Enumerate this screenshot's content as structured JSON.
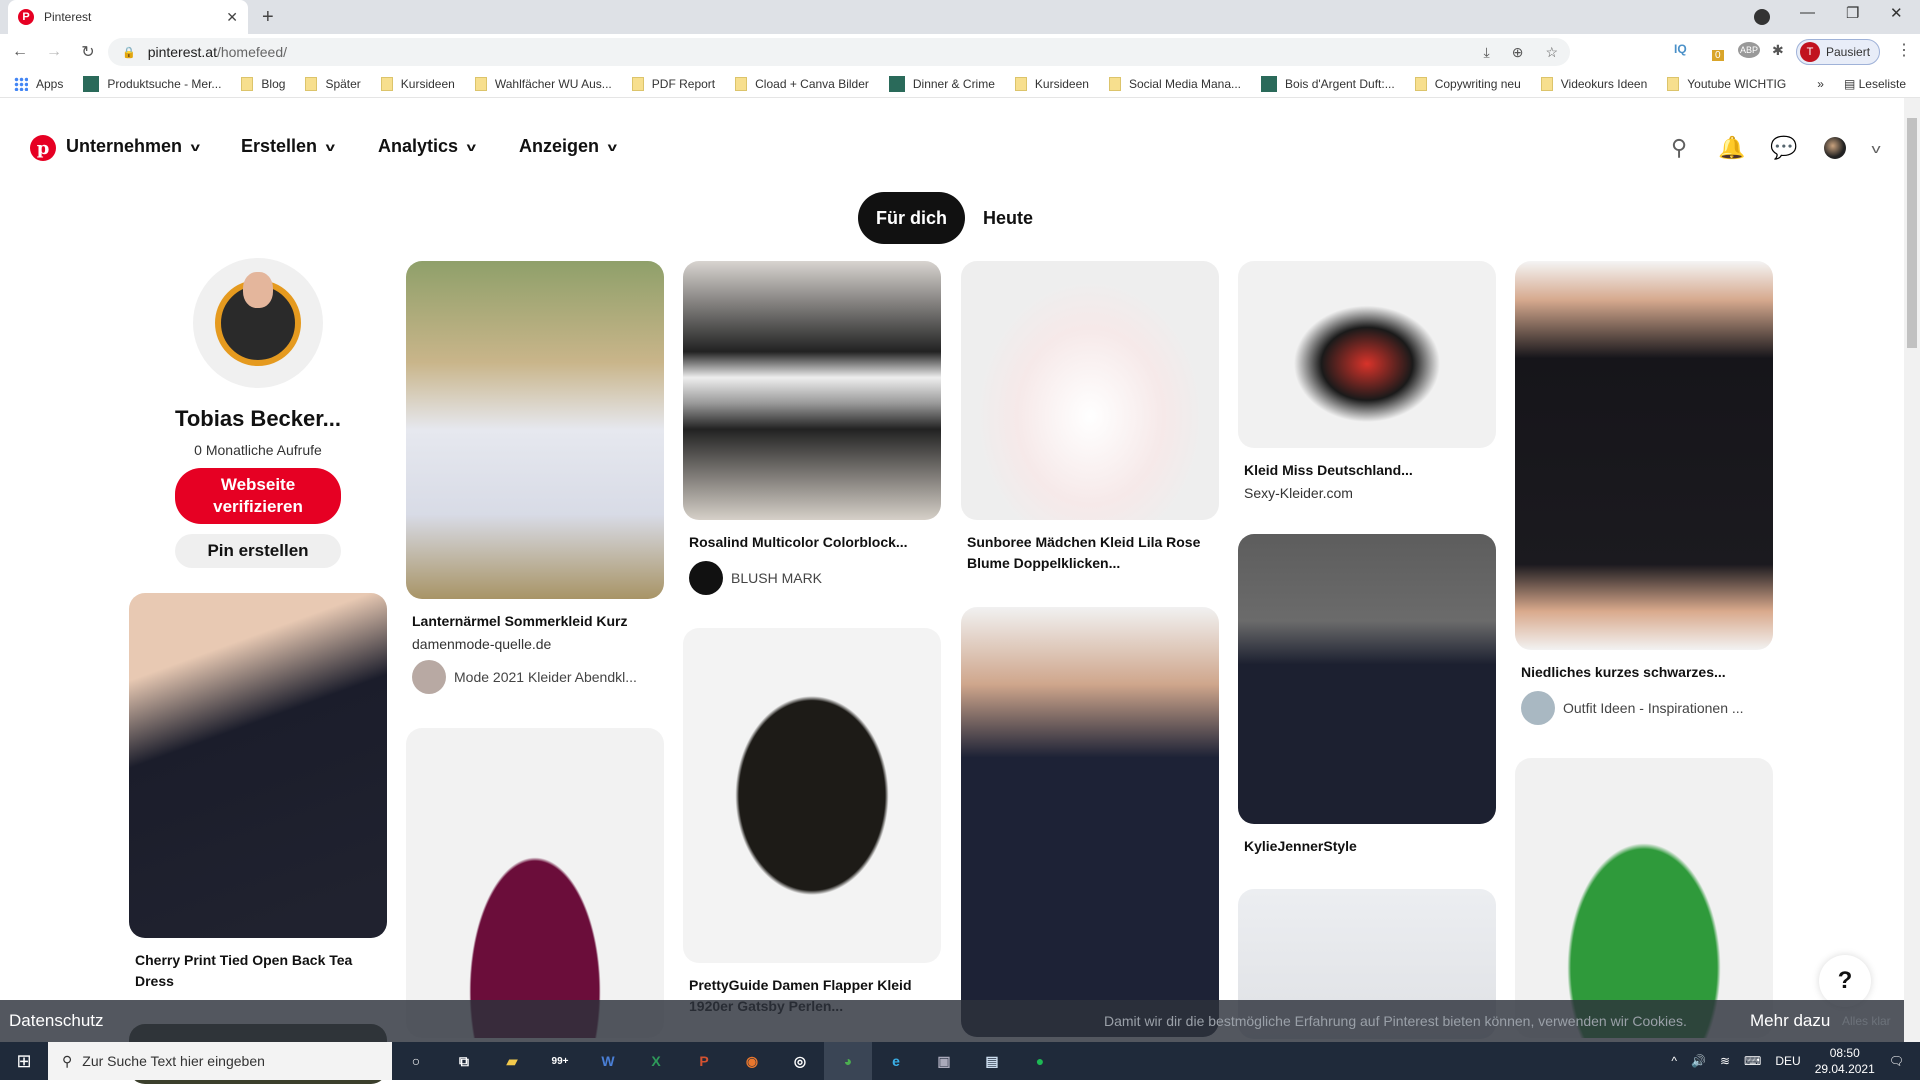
{
  "browser": {
    "tab_title": "Pinterest",
    "url_host": "pinterest.at",
    "url_path": "/homefeed/",
    "profile_label": "Pausiert",
    "profile_initial": "T",
    "extensions": [
      "IQ",
      "0",
      "ABP"
    ],
    "bookmarks": [
      {
        "label": "Apps",
        "icon": "apps-icon"
      },
      {
        "label": "Produktsuche - Mer...",
        "icon": "site-icon"
      },
      {
        "label": "Blog",
        "icon": "folder-icon"
      },
      {
        "label": "Später",
        "icon": "folder-icon"
      },
      {
        "label": "Kursideen",
        "icon": "folder-icon"
      },
      {
        "label": "Wahlfächer WU Aus...",
        "icon": "folder-icon"
      },
      {
        "label": "PDF Report",
        "icon": "folder-icon"
      },
      {
        "label": "Cload + Canva Bilder",
        "icon": "folder-icon"
      },
      {
        "label": "Dinner & Crime",
        "icon": "site-icon"
      },
      {
        "label": "Kursideen",
        "icon": "folder-icon"
      },
      {
        "label": "Social Media Mana...",
        "icon": "folder-icon"
      },
      {
        "label": "Bois d'Argent Duft:...",
        "icon": "site-icon"
      },
      {
        "label": "Copywriting neu",
        "icon": "folder-icon"
      },
      {
        "label": "Videokurs Ideen",
        "icon": "folder-icon"
      },
      {
        "label": "Youtube WICHTIG",
        "icon": "folder-icon"
      }
    ],
    "bookmarks_more": "»",
    "reading_list": "Leseliste"
  },
  "header": {
    "nav": [
      {
        "label": "Unternehmen"
      },
      {
        "label": "Erstellen"
      },
      {
        "label": "Analytics"
      },
      {
        "label": "Anzeigen"
      }
    ]
  },
  "feed_tabs": [
    {
      "label": "Für dich",
      "active": true
    },
    {
      "label": "Heute",
      "active": false
    }
  ],
  "profile": {
    "name": "Tobias Becker...",
    "views": "0 Monatliche Aufrufe",
    "verify_label": "Webseite verifizieren",
    "create_pin_label": "Pin erstellen"
  },
  "pins": [
    {
      "title": "Cherry Print Tied Open Back Tea Dress"
    },
    {
      "title": "Lanternärmel Sommerkleid Kurz",
      "source": "damenmode-quelle.de",
      "board": "Mode 2021 Kleider Abendkl..."
    },
    {
      "title": "Rosalind Multicolor Colorblock...",
      "board": "BLUSH MARK"
    },
    {
      "title": "PrettyGuide Damen Flapper Kleid 1920er Gatsby Perlen..."
    },
    {
      "title": "Sunboree Mädchen Kleid Lila Rose Blume Doppelklicken..."
    },
    {
      "title": "Kleid Miss Deutschland...",
      "source": "Sexy-Kleider.com"
    },
    {
      "title": "KylieJennerStyle"
    },
    {
      "title": "Niedliches kurzes schwarzes...",
      "board": "Outfit Ideen - Inspirationen ..."
    }
  ],
  "cookie_banner": {
    "privacy": "Datenschutz",
    "message": "Damit wir dir die bestmögliche Erfahrung auf Pinterest bieten können, verwenden wir Cookies.",
    "more": "Mehr dazu",
    "accept": "Alles klar"
  },
  "help_label": "?",
  "taskbar": {
    "search_placeholder": "Zur Suche Text hier eingeben",
    "mail_badge": "99+",
    "lang": "DEU",
    "time": "08:50",
    "date": "29.04.2021"
  }
}
